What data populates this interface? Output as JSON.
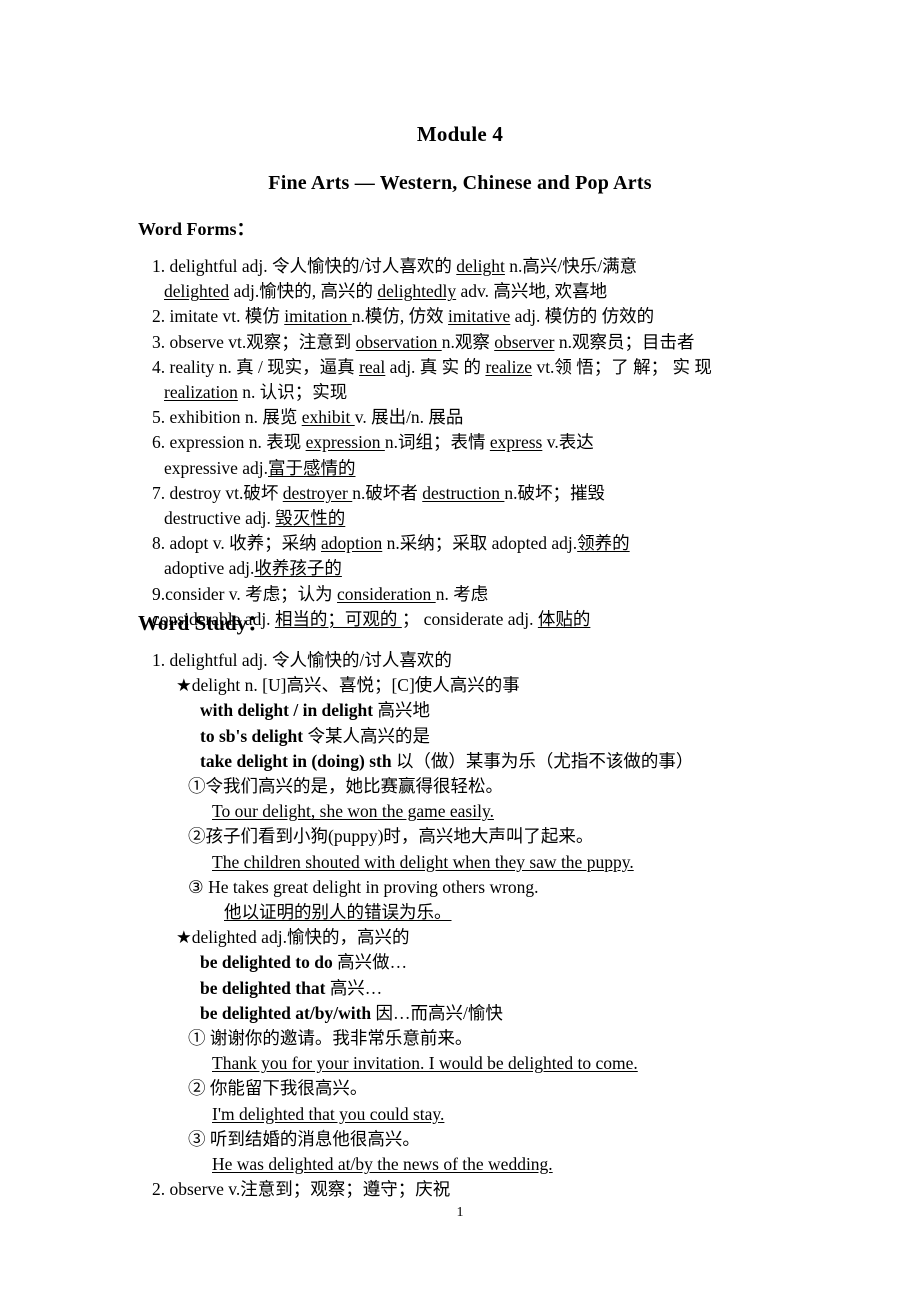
{
  "document": {
    "title": "Module 4",
    "subtitle": "Fine Arts — Western, Chinese and Pop Arts",
    "page_number": "1"
  },
  "word_forms": {
    "heading": "Word Forms：",
    "lines": [
      {
        "id": "wf-1a",
        "indent": 1,
        "parts": [
          {
            "t": "1. delightful adj.  令人愉快的/讨人喜欢的",
            "u": false,
            "b": false
          },
          {
            "t": "  ",
            "u": false,
            "b": false
          },
          {
            "t": "delight",
            "u": true,
            "b": false
          },
          {
            "t": " n.高兴/快乐/满意",
            "u": false,
            "b": false
          }
        ]
      },
      {
        "id": "wf-1b",
        "indent": 2,
        "parts": [
          {
            "t": "delighted",
            "u": true,
            "b": false
          },
          {
            "t": " adj.愉快的, 高兴的    ",
            "u": false,
            "b": false
          },
          {
            "t": "delightedly",
            "u": true,
            "b": false
          },
          {
            "t": " adv.  高兴地, 欢喜地",
            "u": false,
            "b": false
          }
        ]
      },
      {
        "id": "wf-2",
        "indent": 1,
        "parts": [
          {
            "t": "2. imitate vt.  模仿 ",
            "u": false,
            "b": false
          },
          {
            "t": " imitation ",
            "u": true,
            "b": false
          },
          {
            "t": "  n.模仿, 仿效  ",
            "u": false,
            "b": false
          },
          {
            "t": "imitative",
            "u": true,
            "b": false
          },
          {
            "t": " adj.  模仿的  仿效的",
            "u": false,
            "b": false
          }
        ]
      },
      {
        "id": "wf-3",
        "indent": 1,
        "parts": [
          {
            "t": "3. observe vt.观察；注意到 ",
            "u": false,
            "b": false
          },
          {
            "t": " observation ",
            "u": true,
            "b": false
          },
          {
            "t": "  n.观察  ",
            "u": false,
            "b": false
          },
          {
            "t": "observer",
            "u": true,
            "b": false
          },
          {
            "t": " n.观察员；目击者",
            "u": false,
            "b": false
          }
        ]
      },
      {
        "id": "wf-4a",
        "indent": 1,
        "parts": [
          {
            "t": "4. reality n.  真 / 现实，逼真  ",
            "u": false,
            "b": false
          },
          {
            "t": "real",
            "u": true,
            "b": false
          },
          {
            "t": " adj.  真 实 的  ",
            "u": false,
            "b": false
          },
          {
            "t": "realize",
            "u": true,
            "b": false
          },
          {
            "t": " vt.领 悟；了 解； 实 现",
            "u": false,
            "b": false
          }
        ]
      },
      {
        "id": "wf-4b",
        "indent": 2,
        "parts": [
          {
            "t": "realization",
            "u": true,
            "b": false
          },
          {
            "t": " n.  认识；实现",
            "u": false,
            "b": false
          }
        ]
      },
      {
        "id": "wf-5",
        "indent": 1,
        "parts": [
          {
            "t": "5. exhibition n.  展览 ",
            "u": false,
            "b": false
          },
          {
            "t": " exhibit ",
            "u": true,
            "b": false
          },
          {
            "t": "  v. 展出/n. 展品",
            "u": false,
            "b": false
          }
        ]
      },
      {
        "id": "wf-6a",
        "indent": 1,
        "parts": [
          {
            "t": "6. expression n.  表现 ",
            "u": false,
            "b": false
          },
          {
            "t": " expression ",
            "u": true,
            "b": false
          },
          {
            "t": "   n.词组；表情 ",
            "u": false,
            "b": false
          },
          {
            "t": "express",
            "u": true,
            "b": false
          },
          {
            "t": " v.表达",
            "u": false,
            "b": false
          }
        ]
      },
      {
        "id": "wf-6b",
        "indent": 2,
        "parts": [
          {
            "t": "expressive    adj.",
            "u": false,
            "b": false
          },
          {
            "t": "富于感情的",
            "u": true,
            "b": false
          }
        ]
      },
      {
        "id": "wf-7a",
        "indent": 1,
        "parts": [
          {
            "t": "7. destroy vt.破坏 ",
            "u": false,
            "b": false
          },
          {
            "t": " destroyer ",
            "u": true,
            "b": false
          },
          {
            "t": "n.破坏者  ",
            "u": false,
            "b": false
          },
          {
            "t": " destruction ",
            "u": true,
            "b": false
          },
          {
            "t": "  n.破坏；摧毁",
            "u": false,
            "b": false
          }
        ]
      },
      {
        "id": "wf-7b",
        "indent": 2,
        "parts": [
          {
            "t": "destructive adj. ",
            "u": false,
            "b": false
          },
          {
            "t": "毁灭性的",
            "u": true,
            "b": false
          }
        ]
      },
      {
        "id": "wf-8a",
        "indent": 1,
        "parts": [
          {
            "t": "8. adopt v.  收养；采纳 ",
            "u": false,
            "b": false
          },
          {
            "t": "adoption",
            "u": true,
            "b": false
          },
          {
            "t": "   n.采纳；采取  adopted    adj.",
            "u": false,
            "b": false
          },
          {
            "t": "领养的",
            "u": true,
            "b": false
          }
        ]
      },
      {
        "id": "wf-8b",
        "indent": 2,
        "parts": [
          {
            "t": "adoptive adj.",
            "u": false,
            "b": false
          },
          {
            "t": "收养孩子的",
            "u": true,
            "b": false
          }
        ]
      },
      {
        "id": "wf-9a",
        "indent": 1,
        "parts": [
          {
            "t": "9.consider v.  考虑；认为 ",
            "u": false,
            "b": false
          },
          {
            "t": " consideration ",
            "u": true,
            "b": false
          },
          {
            "t": "  n.  考虑",
            "u": false,
            "b": false
          }
        ]
      },
      {
        "id": "wf-9b",
        "indent": 1,
        "parts": [
          {
            "t": " considerable adj. ",
            "u": false,
            "b": false
          },
          {
            "t": " 相当的；可观的 ",
            "u": true,
            "b": false
          },
          {
            "t": "；  considerate adj. ",
            "u": false,
            "b": false
          },
          {
            "t": "体贴的",
            "u": true,
            "b": false
          }
        ]
      }
    ]
  },
  "word_study": {
    "heading": "Word Study：",
    "lines": [
      {
        "id": "ws-1",
        "indent": 1,
        "parts": [
          {
            "t": "1. delightful adj.  令人愉快的/讨人喜欢的",
            "u": false,
            "b": false
          }
        ]
      },
      {
        "id": "ws-1-star1",
        "indent": 3,
        "parts": [
          {
            "t": "★delight n. [U]高兴、喜悦；[C]使人高兴的事",
            "u": false,
            "b": false
          }
        ]
      },
      {
        "id": "ws-1-p1",
        "indent": 5,
        "parts": [
          {
            "t": "with delight / in delight",
            "u": false,
            "b": true
          },
          {
            "t": "  高兴地",
            "u": false,
            "b": false
          }
        ]
      },
      {
        "id": "ws-1-p2",
        "indent": 5,
        "parts": [
          {
            "t": "to sb's delight",
            "u": false,
            "b": true
          },
          {
            "t": "  令某人高兴的是",
            "u": false,
            "b": false
          }
        ]
      },
      {
        "id": "ws-1-p3",
        "indent": 5,
        "parts": [
          {
            "t": "take delight in (doing) sth",
            "u": false,
            "b": true
          },
          {
            "t": "  以（做）某事为乐（尤指不该做的事）",
            "u": false,
            "b": false
          }
        ]
      },
      {
        "id": "ws-1-e1cn",
        "indent": 4,
        "parts": [
          {
            "t": "①令我们高兴的是，她比赛赢得很轻松。",
            "u": false,
            "b": false
          }
        ]
      },
      {
        "id": "ws-1-e1en",
        "indent": 6,
        "parts": [
          {
            "t": "To our delight, she won the game easily.",
            "u": true,
            "b": false
          }
        ]
      },
      {
        "id": "ws-1-e2cn",
        "indent": 4,
        "parts": [
          {
            "t": "②孩子们看到小狗(puppy)时，高兴地大声叫了起来。",
            "u": false,
            "b": false
          }
        ]
      },
      {
        "id": "ws-1-e2en",
        "indent": 6,
        "parts": [
          {
            "t": "The children shouted with delight when they saw the puppy.",
            "u": true,
            "b": false
          }
        ]
      },
      {
        "id": "ws-1-e3en",
        "indent": 4,
        "parts": [
          {
            "t": "③  He takes great delight in proving others wrong.",
            "u": false,
            "b": false
          }
        ]
      },
      {
        "id": "ws-1-e3cn",
        "indent": 7,
        "parts": [
          {
            "t": "他以证明的别人的错误为乐。 ",
            "u": true,
            "b": false
          }
        ]
      },
      {
        "id": "ws-1-star2",
        "indent": 3,
        "parts": [
          {
            "t": "★delighted adj.愉快的，高兴的",
            "u": false,
            "b": false
          }
        ]
      },
      {
        "id": "ws-2-p1",
        "indent": 5,
        "parts": [
          {
            "t": "be delighted to do",
            "u": false,
            "b": true
          },
          {
            "t": "  高兴做…",
            "u": false,
            "b": false
          }
        ]
      },
      {
        "id": "ws-2-p2",
        "indent": 5,
        "parts": [
          {
            "t": "be delighted that",
            "u": false,
            "b": true
          },
          {
            "t": "  高兴…",
            "u": false,
            "b": false
          }
        ]
      },
      {
        "id": "ws-2-p3",
        "indent": 5,
        "parts": [
          {
            "t": "be delighted at/by/with",
            "u": false,
            "b": true
          },
          {
            "t": "   因…而高兴/愉快",
            "u": false,
            "b": false
          }
        ]
      },
      {
        "id": "ws-2-e1cn",
        "indent": 4,
        "parts": [
          {
            "t": "①  谢谢你的邀请。我非常乐意前来。",
            "u": false,
            "b": false
          }
        ]
      },
      {
        "id": "ws-2-e1en",
        "indent": 6,
        "parts": [
          {
            "t": "Thank you for your invitation. I would be delighted to come.",
            "u": true,
            "b": false
          }
        ]
      },
      {
        "id": "ws-2-e2cn",
        "indent": 4,
        "parts": [
          {
            "t": "②  你能留下我很高兴。",
            "u": false,
            "b": false
          }
        ]
      },
      {
        "id": "ws-2-e2en",
        "indent": 6,
        "parts": [
          {
            "t": "I'm delighted that you could stay.",
            "u": true,
            "b": false
          }
        ]
      },
      {
        "id": "ws-2-e3cn",
        "indent": 4,
        "parts": [
          {
            "t": "③  听到结婚的消息他很高兴。",
            "u": false,
            "b": false
          }
        ]
      },
      {
        "id": "ws-2-e3en",
        "indent": 6,
        "parts": [
          {
            "t": "He was delighted at/by the news of the wedding.",
            "u": true,
            "b": false
          }
        ]
      },
      {
        "id": "ws-2",
        "indent": 1,
        "parts": [
          {
            "t": "2. observe v.注意到；观察；遵守；庆祝",
            "u": false,
            "b": false
          }
        ]
      }
    ]
  }
}
